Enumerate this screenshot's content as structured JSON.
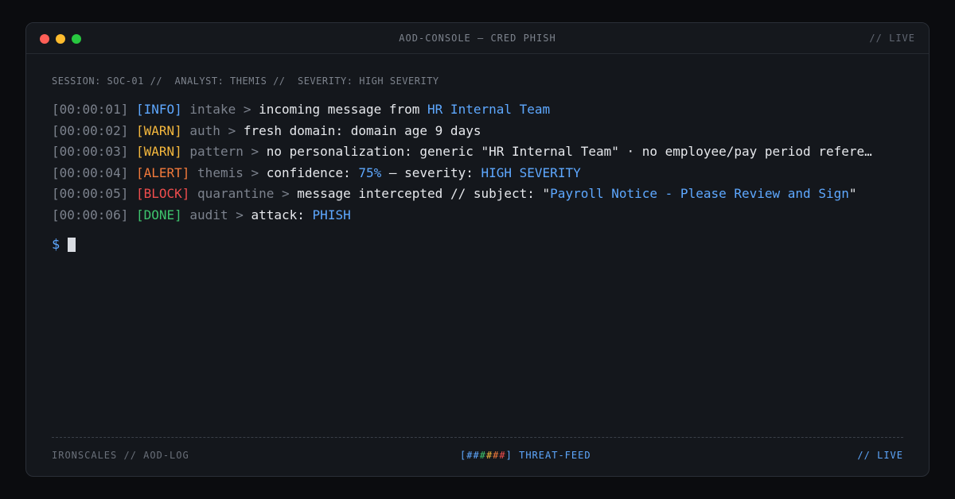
{
  "window": {
    "title": "AOD-CONSOLE — CRED PHISH",
    "live": "// LIVE"
  },
  "session": {
    "text": "SESSION: SOC-01 //  ANALYST: THEMIS //  SEVERITY: HIGH SEVERITY"
  },
  "log": [
    {
      "ts": "[00:00:01]",
      "tag": "[INFO]",
      "tag_color": "#5ea8ff",
      "source": "intake",
      "sep": " > ",
      "parts": [
        {
          "text": "incoming message from ",
          "hl": false
        },
        {
          "text": "HR Internal Team",
          "hl": true
        }
      ]
    },
    {
      "ts": "[00:00:02]",
      "tag": "[WARN]",
      "tag_color": "#f5b83d",
      "source": "auth",
      "sep": " > ",
      "parts": [
        {
          "text": "fresh domain: domain age 9 days",
          "hl": false
        }
      ]
    },
    {
      "ts": "[00:00:03]",
      "tag": "[WARN]",
      "tag_color": "#f5b83d",
      "source": "pattern",
      "sep": " > ",
      "parts": [
        {
          "text": "no personalization: generic \"HR Internal Team\" · no employee/pay period refere…",
          "hl": false
        }
      ]
    },
    {
      "ts": "[00:00:04]",
      "tag": "[ALERT]",
      "tag_color": "#f27a3b",
      "source": "themis",
      "sep": " > ",
      "parts": [
        {
          "text": "confidence: ",
          "hl": false
        },
        {
          "text": "75%",
          "hl": true
        },
        {
          "text": " — severity: ",
          "hl": false
        },
        {
          "text": "HIGH SEVERITY",
          "hl": true
        }
      ]
    },
    {
      "ts": "[00:00:05]",
      "tag": "[BLOCK]",
      "tag_color": "#ef4d4d",
      "source": "quarantine",
      "sep": " > ",
      "parts": [
        {
          "text": "message intercepted // subject: \"",
          "hl": false
        },
        {
          "text": "Payroll Notice - Please Review and Sign",
          "hl": true
        },
        {
          "text": "\"",
          "hl": false
        }
      ]
    },
    {
      "ts": "[00:00:06]",
      "tag": "[DONE]",
      "tag_color": "#3ec46d",
      "source": "audit",
      "sep": " > ",
      "parts": [
        {
          "text": "attack: ",
          "hl": false
        },
        {
          "text": "PHISH",
          "hl": true
        }
      ]
    }
  ],
  "prompt": {
    "symbol": "$"
  },
  "footer": {
    "left": "IRONSCALES // AOD-LOG",
    "feed_open": "[",
    "feed_bars": [
      {
        "char": "#",
        "color": "#5ea8ff"
      },
      {
        "char": "#",
        "color": "#5ea8ff"
      },
      {
        "char": "#",
        "color": "#3ec46d"
      },
      {
        "char": "#",
        "color": "#f5b83d"
      },
      {
        "char": "#",
        "color": "#f27a3b"
      },
      {
        "char": "#",
        "color": "#ef4d4d"
      }
    ],
    "feed_close": "]",
    "feed_label": " THREAT-FEED",
    "right": "// LIVE"
  }
}
